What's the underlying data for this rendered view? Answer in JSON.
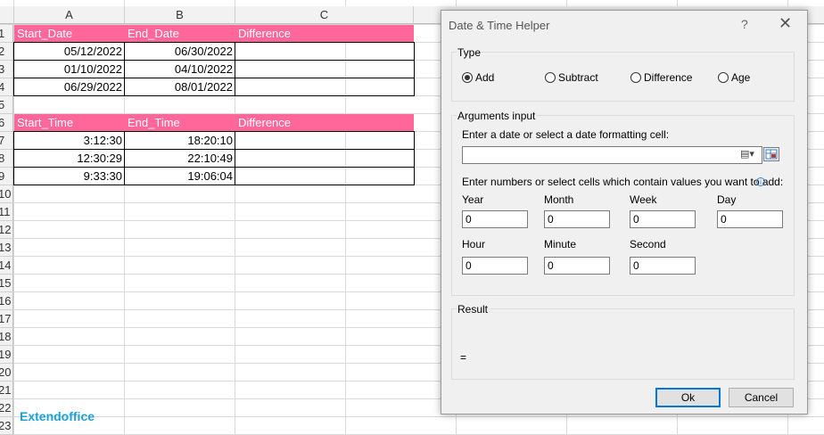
{
  "sheet": {
    "columns": [
      "A",
      "B",
      "C"
    ],
    "rows": [
      "1",
      "2",
      "3",
      "4",
      "5",
      "6",
      "7",
      "8",
      "9",
      "10",
      "11",
      "12",
      "13",
      "14",
      "15",
      "16",
      "17",
      "18",
      "19",
      "20",
      "21",
      "22",
      "23"
    ],
    "table1": {
      "headers": [
        "Start_Date",
        "End_Date",
        "Difference"
      ],
      "rows": [
        [
          "05/12/2022",
          "06/30/2022",
          ""
        ],
        [
          "01/10/2022",
          "04/10/2022",
          ""
        ],
        [
          "06/29/2022",
          "08/01/2022",
          ""
        ]
      ]
    },
    "table2": {
      "headers": [
        "Start_Time",
        "End_Time",
        "Difference"
      ],
      "rows": [
        [
          "3:12:30",
          "18:20:10",
          ""
        ],
        [
          "12:30:29",
          "22:10:49",
          ""
        ],
        [
          "9:33:30",
          "19:06:04",
          ""
        ]
      ]
    },
    "header_color": "#ff6699",
    "brand": "Extendoffice"
  },
  "dialog": {
    "title": "Date & Time Helper",
    "help": "?",
    "close": "✕",
    "type_group": {
      "label": "Type",
      "options": [
        "Add",
        "Subtract",
        "Difference",
        "Age"
      ],
      "selected": "Add"
    },
    "args_group": {
      "label": "Arguments input",
      "date_prompt": "Enter a date or select a date formatting cell:",
      "date_value": "",
      "numbers_prompt": "Enter numbers or select cells which contain values you want to add:",
      "fields": {
        "year": {
          "label": "Year",
          "value": "0"
        },
        "month": {
          "label": "Month",
          "value": "0"
        },
        "week": {
          "label": "Week",
          "value": "0"
        },
        "day": {
          "label": "Day",
          "value": "0"
        },
        "hour": {
          "label": "Hour",
          "value": "0"
        },
        "minute": {
          "label": "Minute",
          "value": "0"
        },
        "second": {
          "label": "Second",
          "value": "0"
        }
      }
    },
    "result_group": {
      "label": "Result",
      "value": "="
    },
    "ok_label": "Ok",
    "cancel_label": "Cancel"
  }
}
